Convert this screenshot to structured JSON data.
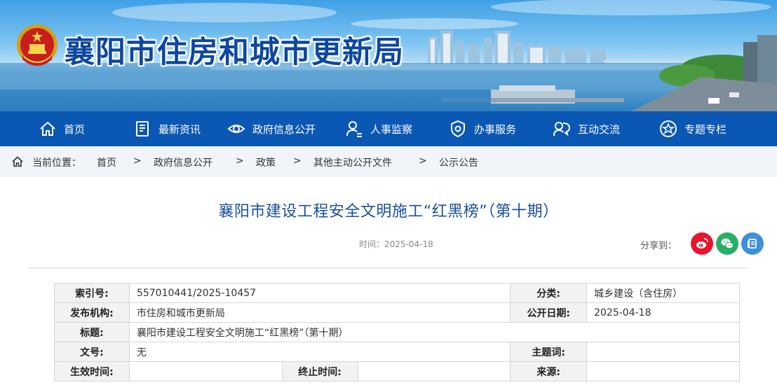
{
  "header": {
    "site_title": "襄阳市住房和城市更新局"
  },
  "nav": {
    "items": [
      {
        "label": "首页",
        "icon": "home-icon"
      },
      {
        "label": "最新资讯",
        "icon": "news-icon"
      },
      {
        "label": "政府信息公开",
        "icon": "eye-icon"
      },
      {
        "label": "人事监察",
        "icon": "person-icon"
      },
      {
        "label": "办事服务",
        "icon": "shield-icon"
      },
      {
        "label": "互动交流",
        "icon": "chat-users-icon"
      },
      {
        "label": "专题专栏",
        "icon": "star-icon"
      }
    ]
  },
  "breadcrumb": {
    "prefix": "当前位置：",
    "items": [
      "首页",
      "政府信息公开",
      "政策",
      "其他主动公开文件",
      "公示公告"
    ],
    "separator": ">"
  },
  "article": {
    "title": "襄阳市建设工程安全文明施工“红黑榜”（第十期）",
    "time": "时间：2025-04-18",
    "share_label": "分享到：",
    "share": [
      "weibo-icon",
      "wechat-icon",
      "qzone-icon"
    ]
  },
  "meta_table": {
    "index_label": "索引号:",
    "index_value": "557010441/2025-10457",
    "category_label": "分类:",
    "category_value": "城乡建设（含住房）",
    "publisher_label": "发布机构:",
    "publisher_value": "市住房和城市更新局",
    "pubdate_label": "公开日期:",
    "pubdate_value": "2025-04-18",
    "title_label": "标题:",
    "title_value": "襄阳市建设工程安全文明施工“红黑榜”（第十期）",
    "docno_label": "文号:",
    "docno_value": "无",
    "keywords_label": "主题词:",
    "keywords_value": "",
    "effective_label": "生效时间:",
    "effective_value": "",
    "end_label": "终止时间:",
    "end_value": "",
    "source_label": "来源:",
    "source_value": ""
  },
  "colors": {
    "nav_bg": "#0b57b4",
    "title_blue": "#1a4f9c",
    "weibo": "#e6162d",
    "wechat": "#2aae67",
    "qzone": "#3d8fe0"
  }
}
